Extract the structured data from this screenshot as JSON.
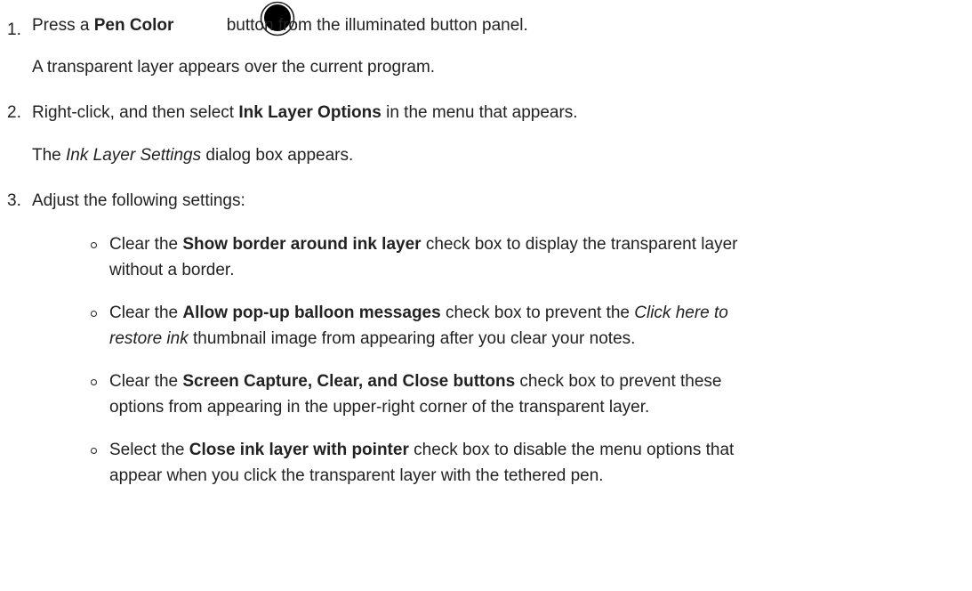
{
  "steps": [
    {
      "number": "1.",
      "text_parts": [
        "Press a ",
        "Pen Color",
        " button from the illuminated button panel."
      ],
      "result": "A transparent layer appears over the current program."
    },
    {
      "number": "2.",
      "text_parts": [
        "Right-click, and then select ",
        "Ink Layer Options",
        " in the menu that appears."
      ],
      "result_parts": [
        "The ",
        "Ink Layer Settings",
        " dialog box appears."
      ]
    },
    {
      "number": "3.",
      "text": "Adjust the following settings:",
      "bullets": [
        {
          "line1_parts": [
            "Clear the ",
            "Show border around ink layer",
            " check box to display the transparent layer"
          ],
          "line2": "without a border."
        },
        {
          "line1_parts": [
            "Clear the ",
            "Allow pop-up balloon messages",
            " check box to prevent the ",
            "Click here to"
          ],
          "line2_parts": [
            "restore ink",
            " thumbnail image from appearing after you clear your notes."
          ]
        },
        {
          "line1_parts": [
            "Clear the ",
            "Screen Capture, Clear, and Close buttons",
            " check box to prevent these"
          ],
          "line2": "options from appearing in the upper-right corner of the transparent layer."
        },
        {
          "line1_parts": [
            "Select the ",
            "Close ink layer with pointer",
            " check box to disable the menu options that"
          ],
          "line2": "appear when you click the transparent layer with the tethered pen."
        }
      ]
    }
  ],
  "icons": {
    "pen_color": "pen-color-button-icon"
  }
}
